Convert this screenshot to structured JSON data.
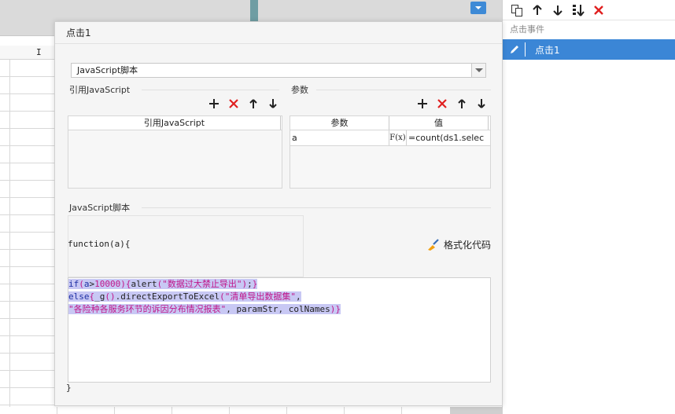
{
  "sheet": {
    "column_header": "I"
  },
  "right_panel": {
    "toolbar": [
      "copy-icon",
      "arrow-up-icon",
      "arrow-down-icon",
      "move-bottom-icon",
      "delete-icon"
    ],
    "section_label": "点击事件",
    "event_item": "点击1"
  },
  "dialog": {
    "title": "点击1",
    "type_select": "JavaScript脚本",
    "ref_section": "引用JavaScript",
    "ref_table_header": "引用JavaScript",
    "param_section": "参数",
    "param_table": {
      "headers": [
        "参数",
        "值"
      ],
      "rows": [
        {
          "name": "a",
          "value": "=count(ds1.selec"
        }
      ]
    },
    "formula_button": "F(x)",
    "script_section": "JavaScript脚本",
    "function_signature": "function(a){",
    "format_button": "格式化代码",
    "code_lines": [
      "if(a>10000){alert(\"数据过大禁止导出\");}",
      "else{_g().directExportToExcel(\"清单导出数据集\",",
      "\"各险种各服务环节的诉因分布情况报表\", paramStr, colNames)}"
    ],
    "closing_brace": "}"
  },
  "colors": {
    "accent": "#3b86d6",
    "delete_red": "#e02020",
    "selection": "#c8c8f4",
    "string_magenta": "#c0168a",
    "keyword_blue": "#1d2fa3"
  }
}
